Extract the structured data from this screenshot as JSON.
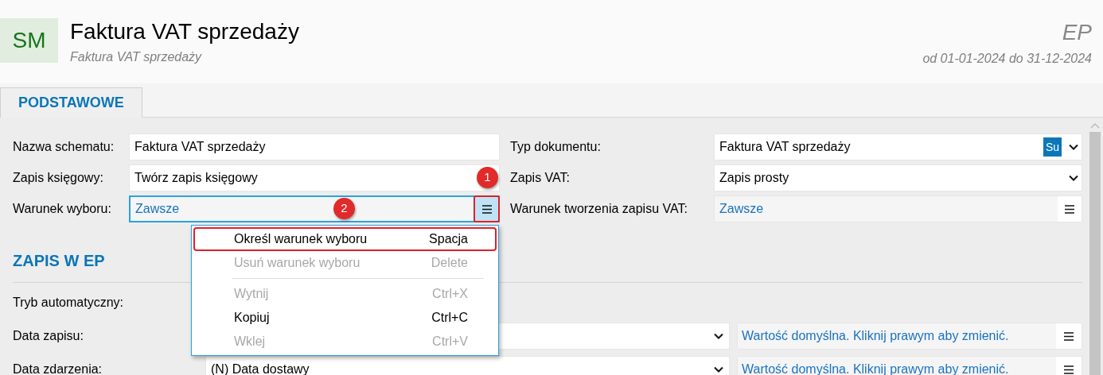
{
  "header": {
    "logo": "SM",
    "title": "Faktura VAT sprzedaży",
    "subtitle": "Faktura VAT sprzedaży",
    "code": "EP",
    "period": "od 01-01-2024 do 31-12-2024"
  },
  "tabs": [
    {
      "label": "PODSTAWOWE",
      "selected": true
    }
  ],
  "fields_left": [
    {
      "label": "Nazwa schematu:",
      "value": "Faktura VAT sprzedaży",
      "kind": "text",
      "focused": false
    },
    {
      "label": "Zapis księgowy:",
      "value": "Twórz zapis księgowy",
      "kind": "text",
      "focused": false
    },
    {
      "label": "Warunek wyboru:",
      "value": "Zawsze",
      "kind": "condition",
      "focused": true
    }
  ],
  "fields_right": [
    {
      "label": "Typ dokumentu:",
      "value": "Faktura VAT sprzedaży",
      "kind": "select",
      "badge": "Su"
    },
    {
      "label": "Zapis VAT:",
      "value": "Zapis prosty",
      "kind": "select"
    },
    {
      "label": "Warunek tworzenia zapisu VAT:",
      "value": "Zawsze",
      "kind": "condition"
    }
  ],
  "section": {
    "title": "ZAPIS W EP",
    "rows": [
      {
        "label": "Tryb automatyczny:",
        "kind": "label"
      },
      {
        "label": "Data zapisu:",
        "kind": "select",
        "condition": "Wartość domyślna. Kliknij prawym aby zmienić."
      },
      {
        "label": "Data zdarzenia:",
        "kind": "select",
        "value": "(N) Data dostawy",
        "condition": "Wartość domyślna. Kliknij prawym aby zmienić."
      }
    ]
  },
  "context_menu": {
    "items": [
      {
        "label": "Określ warunek wyboru",
        "shortcut": "Spacja",
        "disabled": false,
        "highlighted": true,
        "separator_after": false
      },
      {
        "label": "Usuń warunek wyboru",
        "shortcut": "Delete",
        "disabled": true,
        "highlighted": false,
        "separator_after": true
      },
      {
        "label": "Wytnij",
        "shortcut": "Ctrl+X",
        "disabled": true,
        "highlighted": false,
        "separator_after": false
      },
      {
        "label": "Kopiuj",
        "shortcut": "Ctrl+C",
        "disabled": false,
        "highlighted": false,
        "separator_after": false
      },
      {
        "label": "Wklej",
        "shortcut": "Ctrl+V",
        "disabled": true,
        "highlighted": false,
        "separator_after": false
      }
    ]
  },
  "annotations": [
    {
      "number": "1"
    },
    {
      "number": "2"
    }
  ]
}
